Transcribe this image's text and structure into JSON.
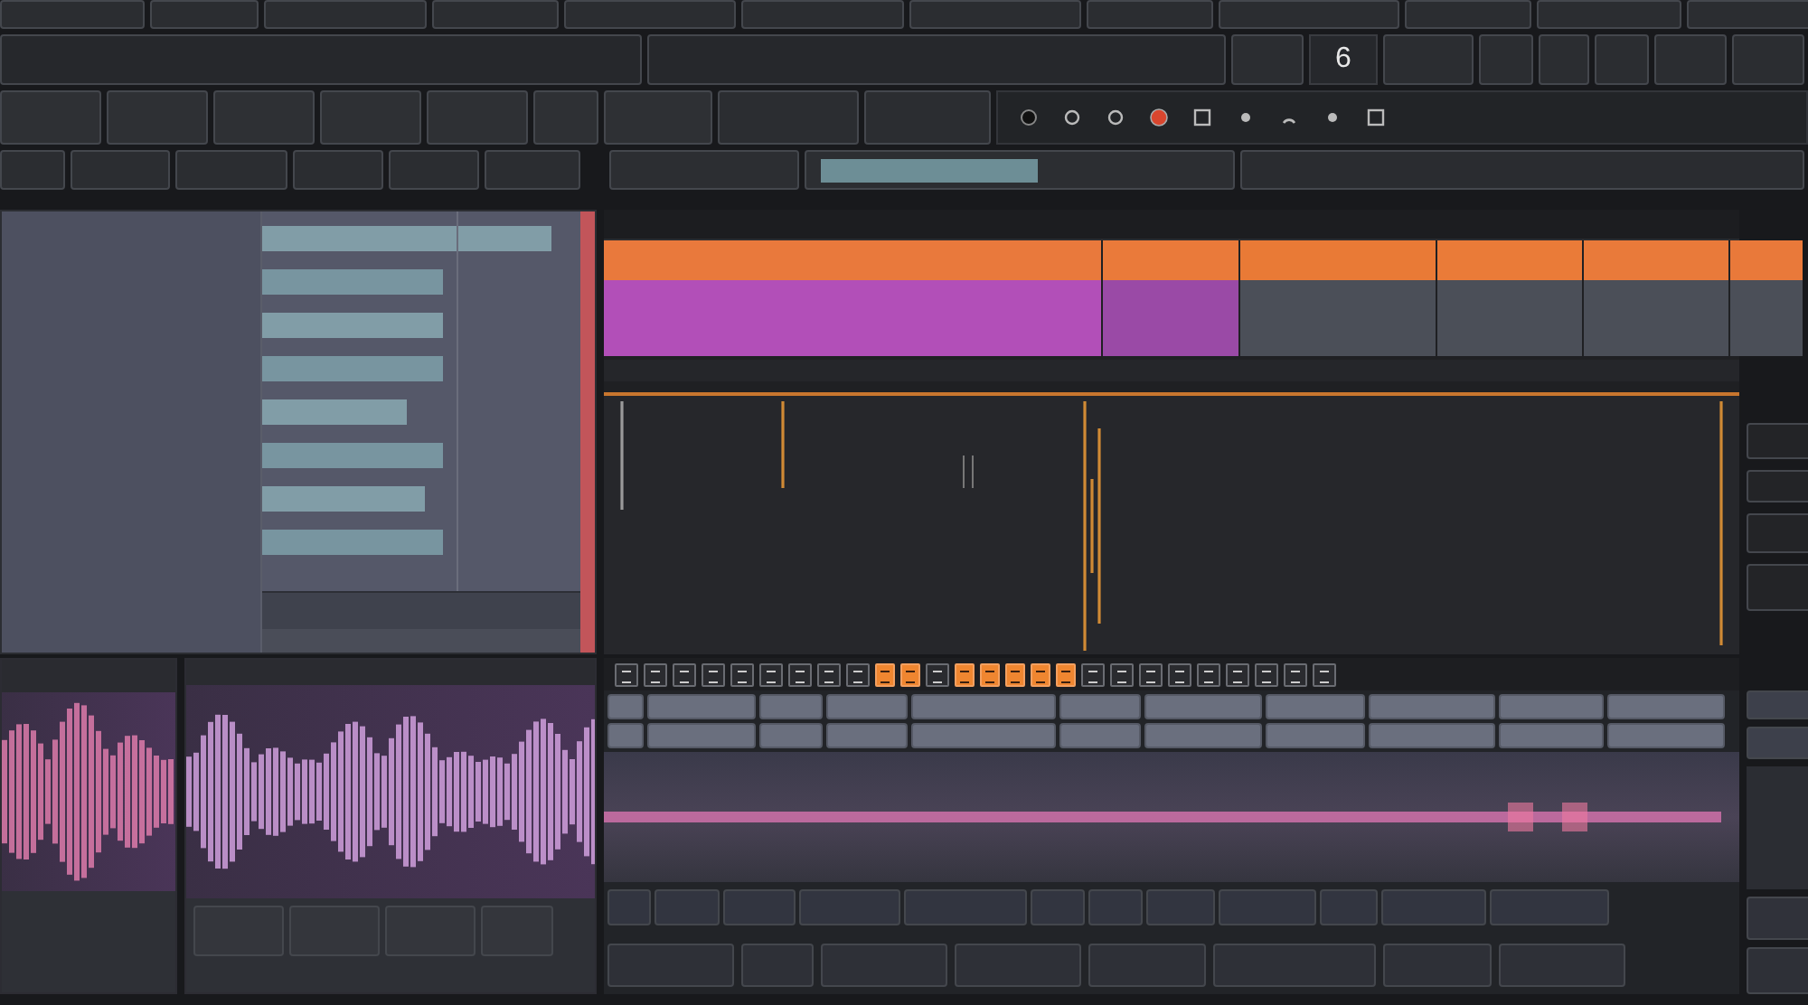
{
  "top_bar": {
    "display_value": "6"
  },
  "transport": {
    "record": {
      "on": true
    }
  },
  "arrange": {
    "lanes": [
      {
        "clips": [
          {
            "color": "#e9793c"
          },
          {
            "color": "#ea7a3a"
          },
          {
            "color": "#e97a36"
          },
          {
            "color": "#ea7b38"
          },
          {
            "color": "#e97a3a"
          },
          {
            "color": "#e9793a"
          }
        ]
      },
      {
        "clips": [
          {
            "color": "#b24fb8"
          },
          {
            "color": "#9a4aa6"
          },
          {
            "color": "#4b4f58"
          },
          {
            "color": "#4b4f58"
          },
          {
            "color": "#4b4f58"
          },
          {
            "color": "#4b4f58"
          }
        ]
      }
    ]
  },
  "toolbar": {
    "toggles": [
      {
        "selected": false
      },
      {
        "selected": false
      },
      {
        "selected": false
      },
      {
        "selected": false
      },
      {
        "selected": false
      },
      {
        "selected": false
      },
      {
        "selected": false
      },
      {
        "selected": false
      },
      {
        "selected": false
      },
      {
        "selected": true
      },
      {
        "selected": true
      },
      {
        "selected": false
      },
      {
        "selected": true
      },
      {
        "selected": true
      },
      {
        "selected": true
      },
      {
        "selected": true
      },
      {
        "selected": true
      },
      {
        "selected": false
      },
      {
        "selected": false
      },
      {
        "selected": false
      },
      {
        "selected": false
      },
      {
        "selected": false
      },
      {
        "selected": false
      },
      {
        "selected": false
      },
      {
        "selected": false
      },
      {
        "selected": false
      }
    ]
  }
}
